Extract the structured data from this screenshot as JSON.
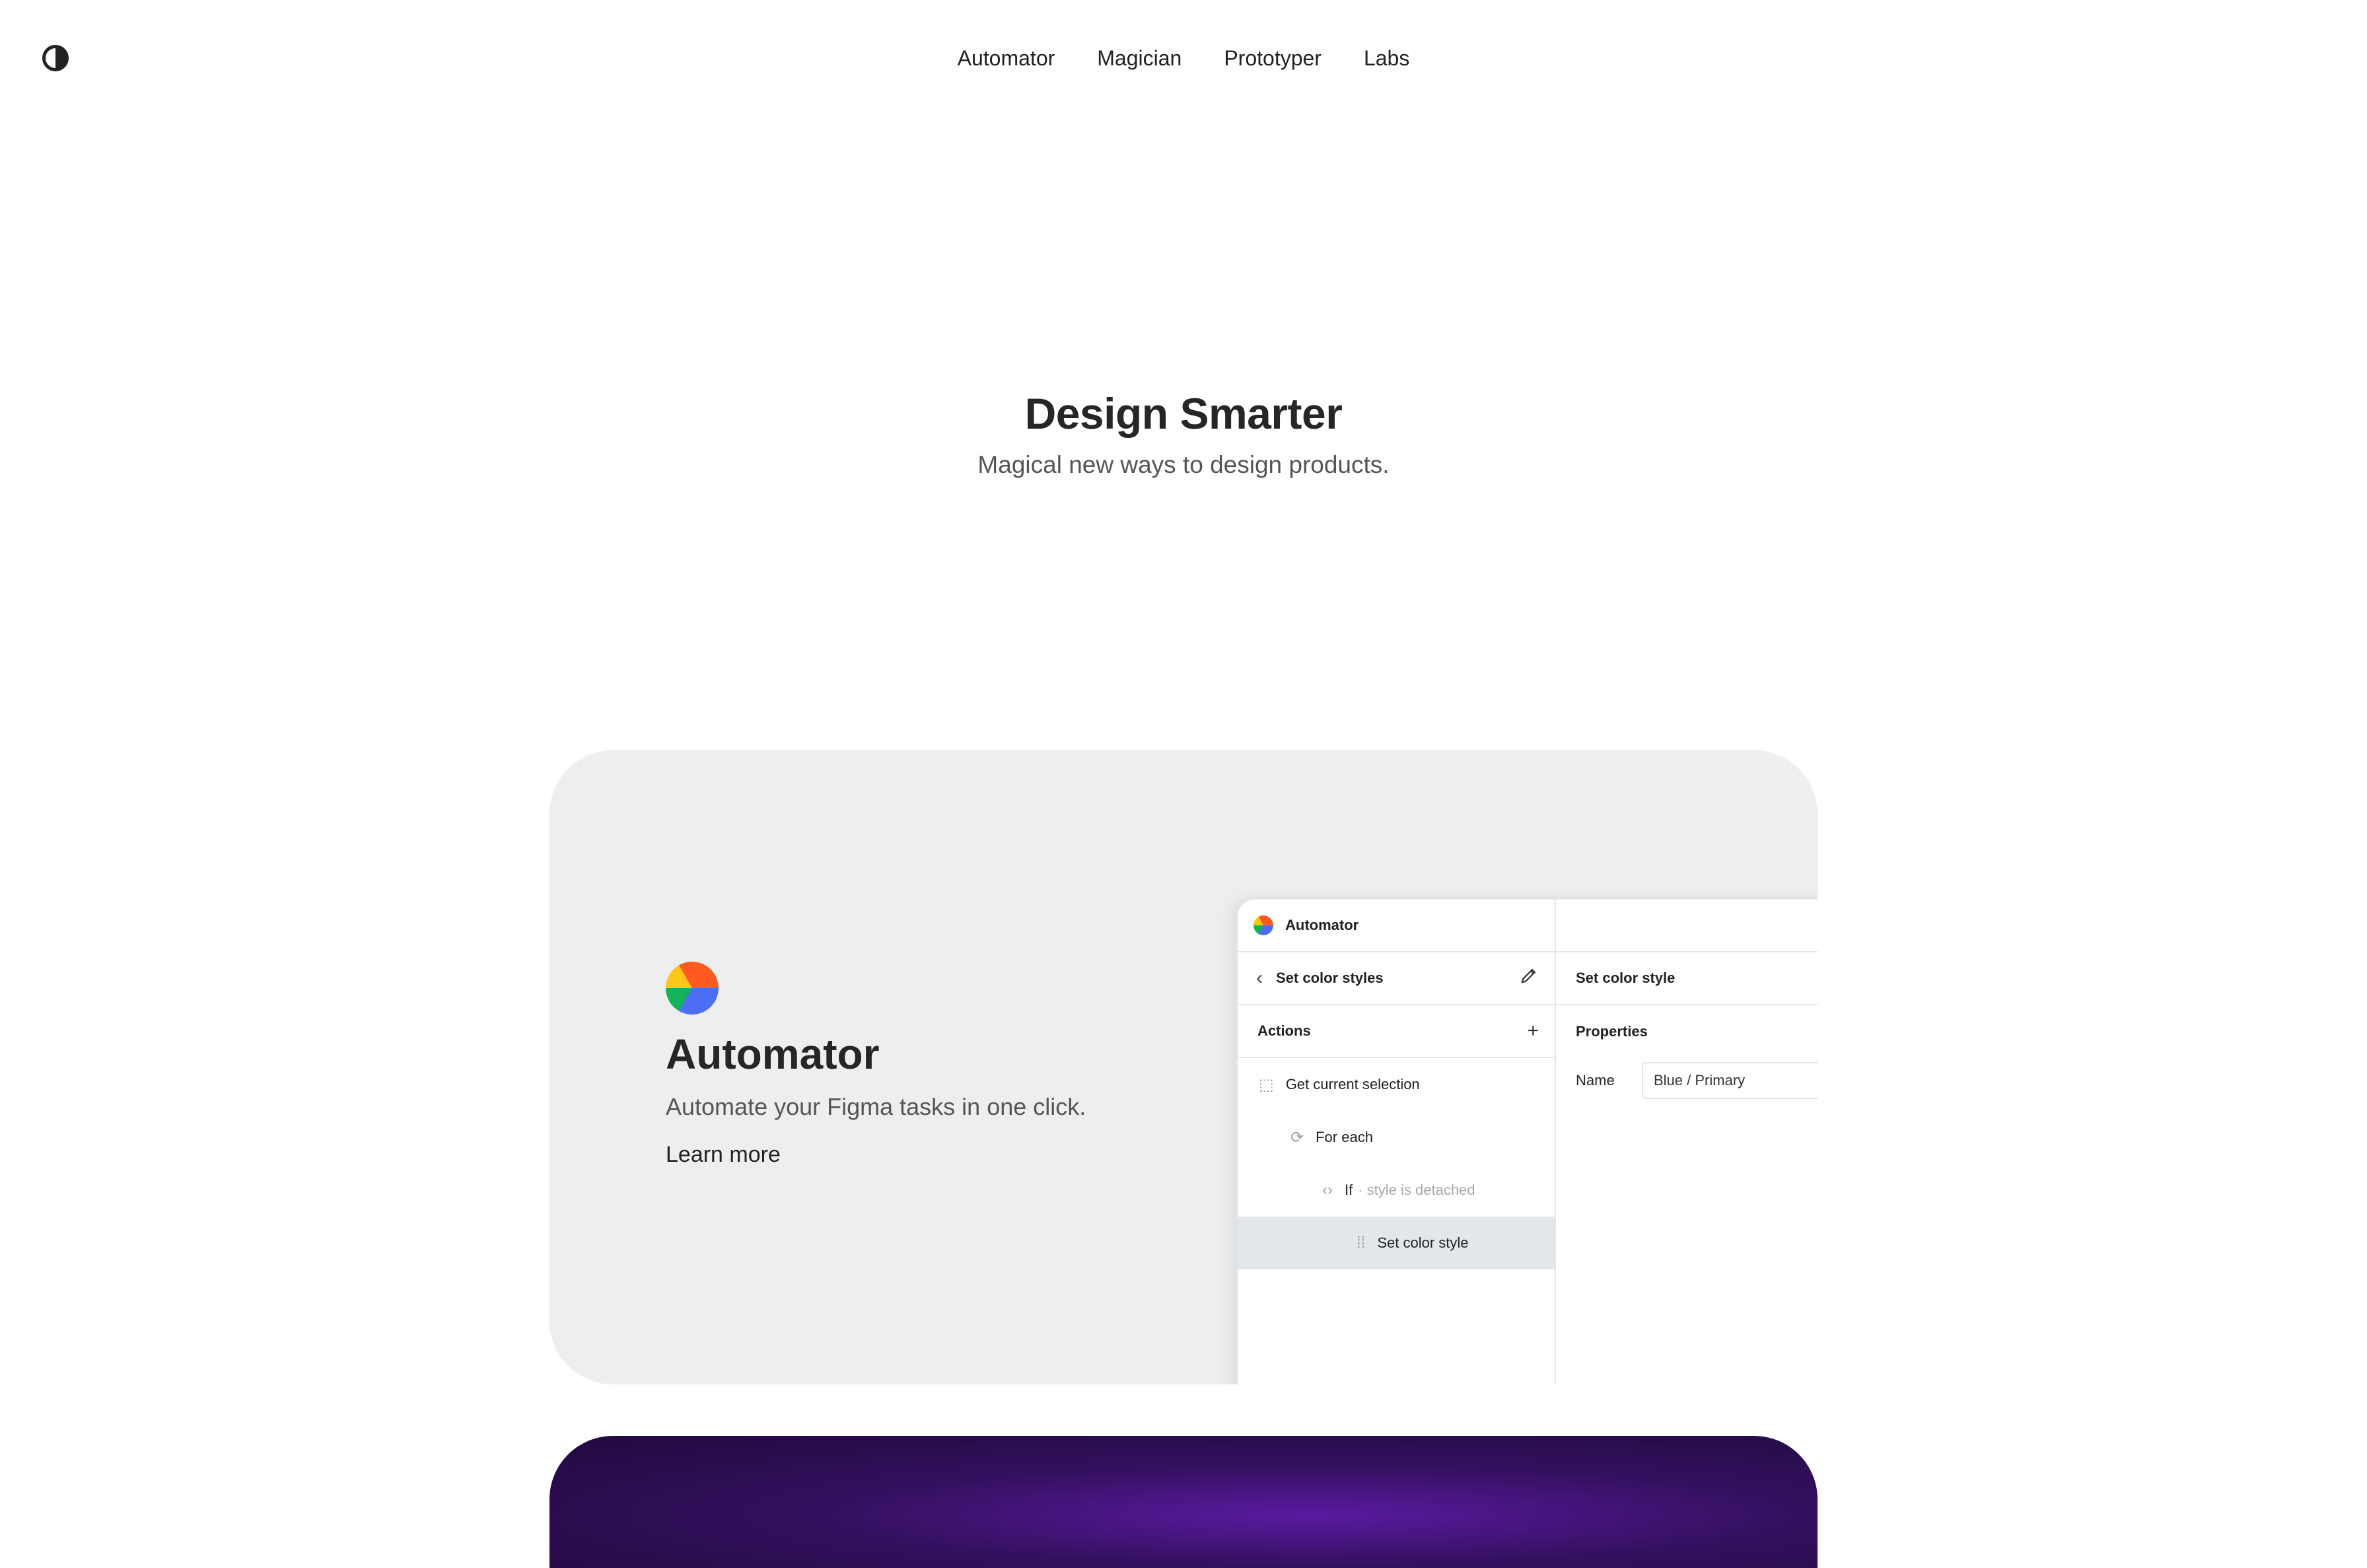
{
  "nav": {
    "items": [
      "Automator",
      "Magician",
      "Prototyper",
      "Labs"
    ]
  },
  "hero": {
    "title": "Design Smarter",
    "subtitle": "Magical new ways to design products."
  },
  "feature": {
    "title": "Automator",
    "subtitle": "Automate your Figma tasks in one click.",
    "link": "Learn more"
  },
  "app": {
    "name": "Automator",
    "left": {
      "back_title": "Set color styles",
      "actions_label": "Actions",
      "steps": [
        {
          "label": "Get current selection"
        },
        {
          "label": "For each"
        },
        {
          "label": "If",
          "detail": "· style is detached"
        },
        {
          "label": "Set color style"
        }
      ]
    },
    "right": {
      "header": "Set color style",
      "section": "Properties",
      "field_label": "Name",
      "field_value": "Blue / Primary"
    }
  },
  "colors": {
    "card_bg": "#eceef0",
    "bottom_card": "#33105e"
  }
}
